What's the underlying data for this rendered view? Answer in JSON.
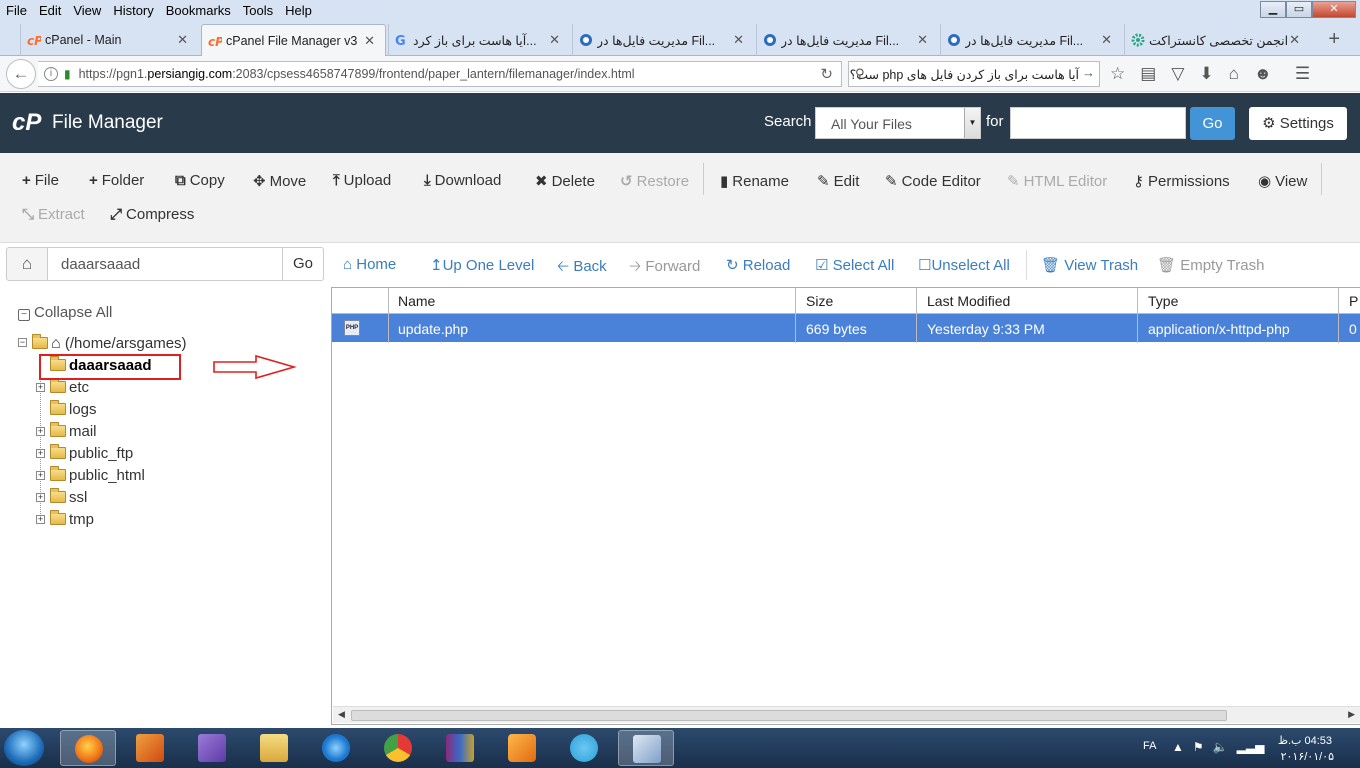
{
  "menu": [
    "File",
    "Edit",
    "View",
    "History",
    "Bookmarks",
    "Tools",
    "Help"
  ],
  "window_controls": {
    "minimize": "▁",
    "restore": "▭",
    "close": "✕"
  },
  "tabs": [
    {
      "label": "cPanel - Main",
      "icon": "cpanel-icon",
      "active": false
    },
    {
      "label": "cPanel File Manager v3",
      "icon": "cpanel-icon",
      "active": true
    },
    {
      "label": "آیا هاست برای باز کرد...",
      "icon": "google-icon",
      "active": false
    },
    {
      "label": "مدیریت فایل‌ها در Fil...",
      "icon": "site-icon",
      "active": false
    },
    {
      "label": "مدیریت فایل‌ها در Fil...",
      "icon": "site-icon",
      "active": false
    },
    {
      "label": "مدیریت فایل‌ها در Fil...",
      "icon": "site-icon",
      "active": false
    },
    {
      "label": "انجمن تخصصی کانستراکت",
      "icon": "gear-icon",
      "active": false
    }
  ],
  "url": {
    "prefix": "https://pgn1.",
    "domain": "persiangig.com",
    "rest": ":2083/cpsess4658747899/frontend/paper_lantern/filemanager/index.html"
  },
  "browser_search": "آیا هاست برای باز کردن فایل های php ست؟",
  "header": {
    "title": "File Manager",
    "search_label": "Search",
    "search_scope": "All Your Files",
    "for_label": "for",
    "for_value": "",
    "go": "Go",
    "settings": "Settings"
  },
  "toolbar": {
    "file": "File",
    "folder": "Folder",
    "copy": "Copy",
    "move": "Move",
    "upload": "Upload",
    "download": "Download",
    "delete": "Delete",
    "restore": "Restore",
    "rename": "Rename",
    "edit": "Edit",
    "code_editor": "Code Editor",
    "html_editor": "HTML Editor",
    "permissions": "Permissions",
    "view": "View",
    "extract": "Extract",
    "compress": "Compress"
  },
  "path": {
    "value": "daaarsaaad",
    "go": "Go"
  },
  "nav": {
    "home": "Home",
    "up_one_level": "Up One Level",
    "back": "Back",
    "forward": "Forward",
    "reload": "Reload",
    "select_all": "Select All",
    "unselect_all": "Unselect All",
    "view_trash": "View Trash",
    "empty_trash": "Empty Trash"
  },
  "tree": {
    "collapse_all": "Collapse All",
    "root": "(/home/arsgames)",
    "items": [
      "daaarsaaad",
      "etc",
      "logs",
      "mail",
      "public_ftp",
      "public_html",
      "ssl",
      "tmp"
    ]
  },
  "table": {
    "columns": [
      "Name",
      "Size",
      "Last Modified",
      "Type",
      "P"
    ],
    "rows": [
      {
        "name": "update.php",
        "size": "669 bytes",
        "modified": "Yesterday 9:33 PM",
        "type": "application/x-httpd-php",
        "perm": "0"
      }
    ]
  },
  "file_icon_text": "PHP",
  "taskbar": {
    "lang": "FA",
    "time": "04:53 ب.ظ",
    "date": "۲۰۱۶/۰۱/۰۵"
  },
  "colors": {
    "header_bg": "#293a4a",
    "accent_blue": "#4294d6",
    "selected_row": "#4a81d9",
    "link_blue": "#3b7dbf",
    "highlight_red": "#e02020"
  }
}
